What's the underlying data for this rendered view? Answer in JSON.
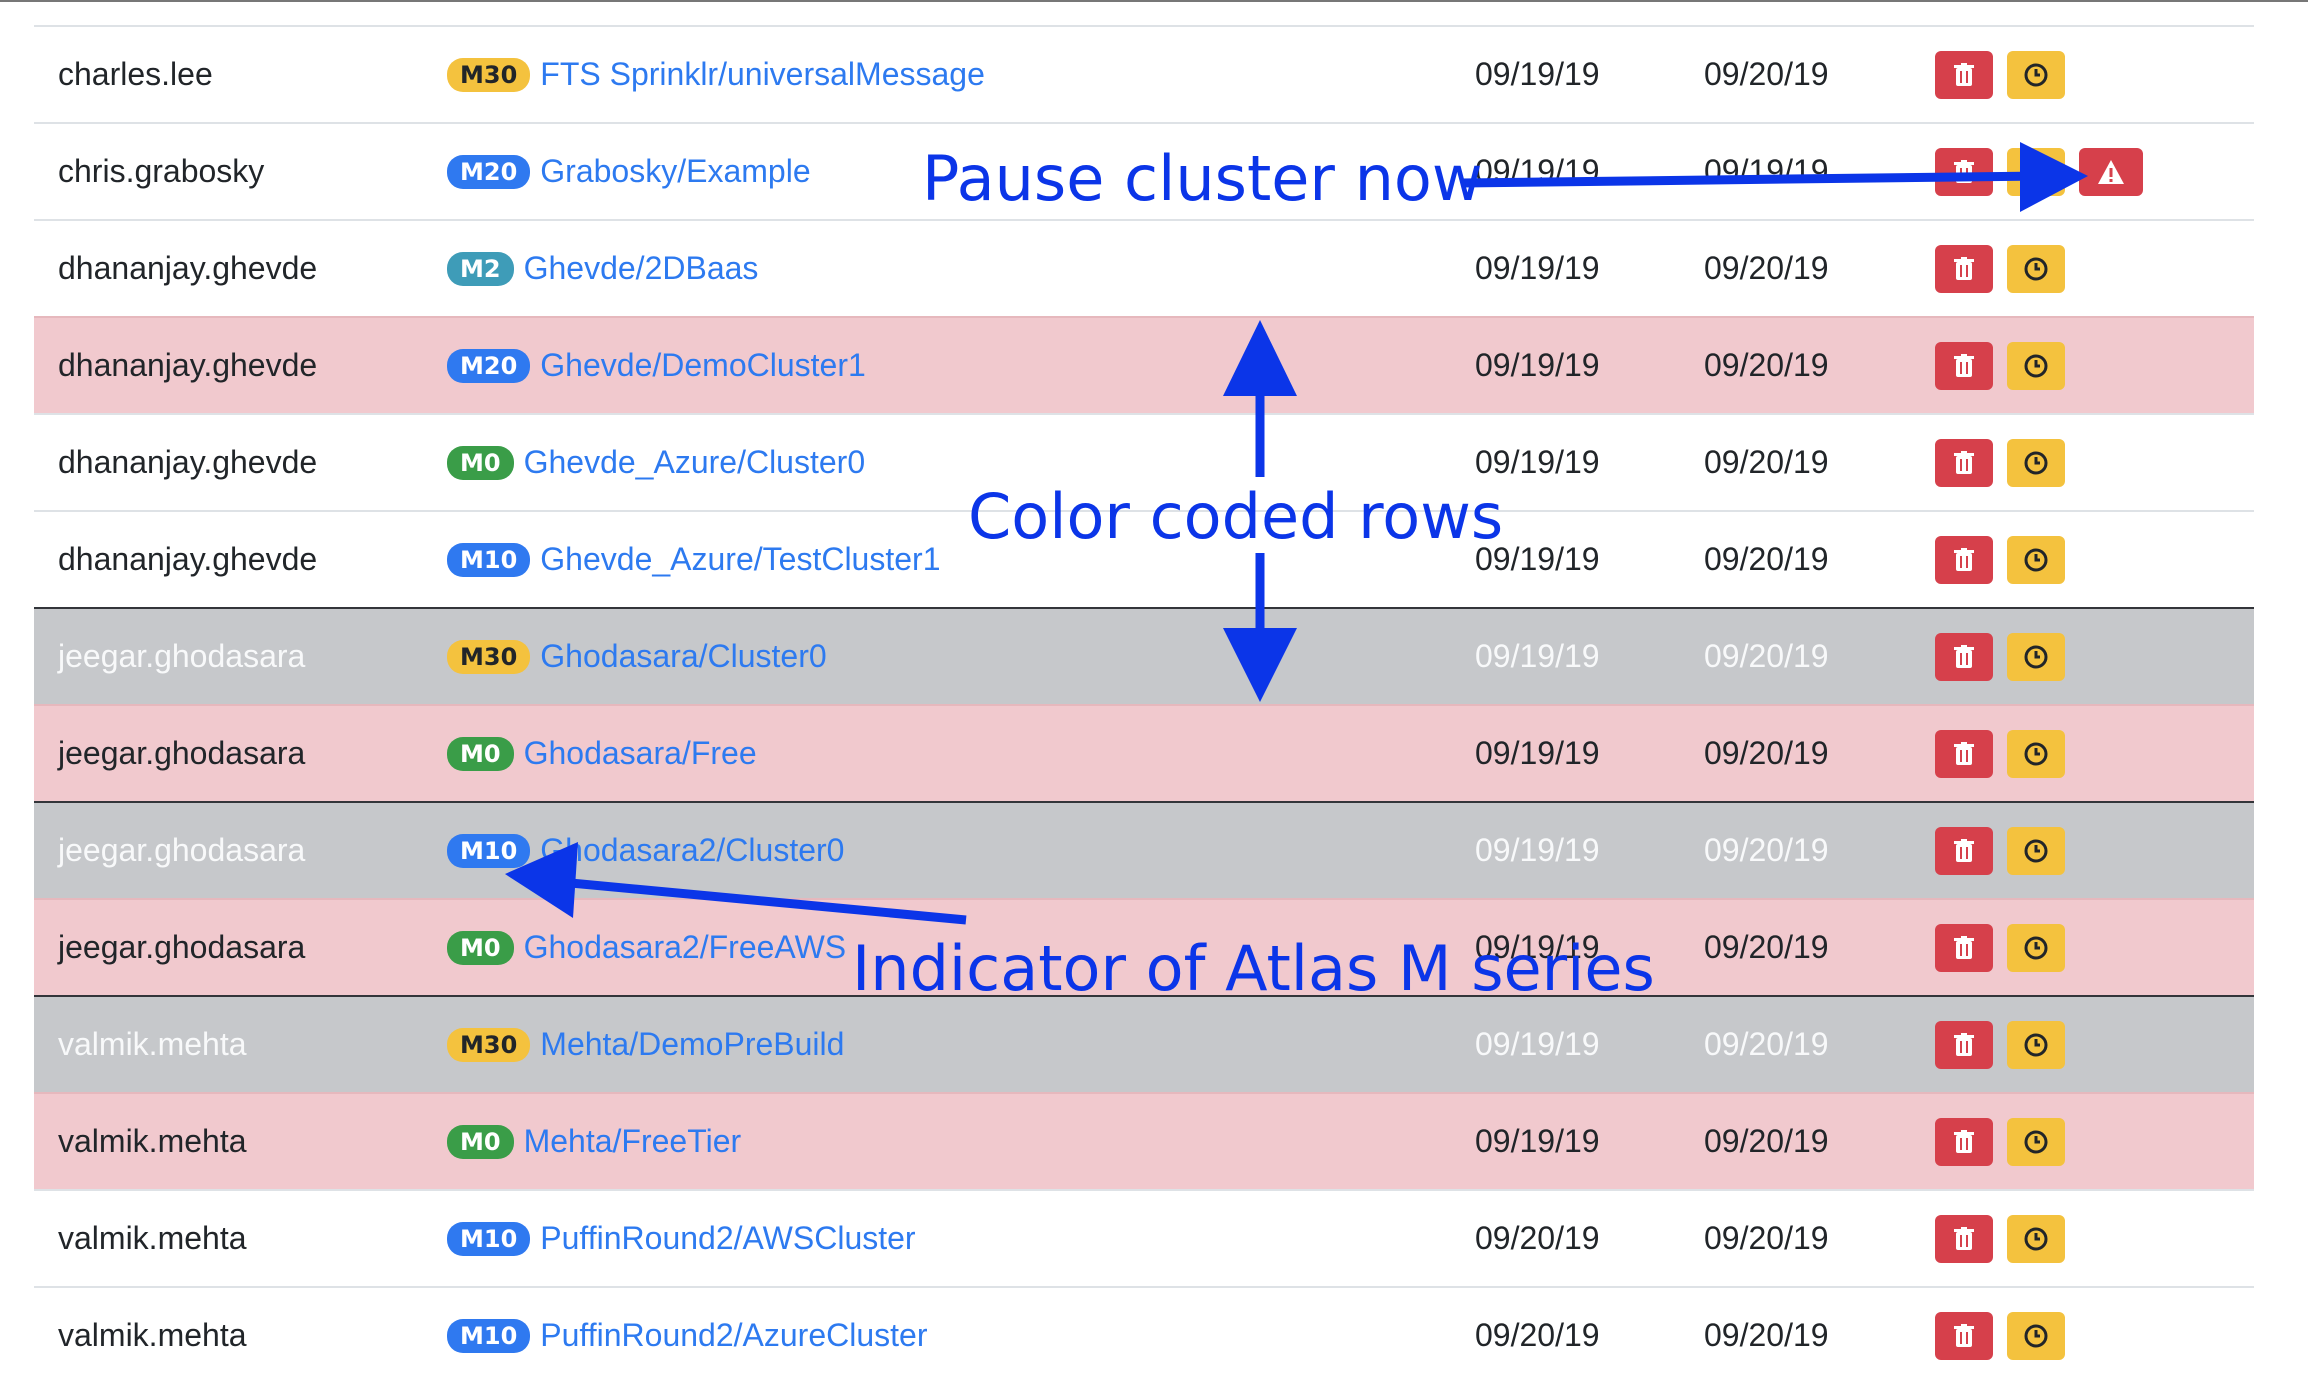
{
  "colors": {
    "link": "#2d7af0",
    "danger_row": "#f1c9ce",
    "secondary_row": "#c6c8cb",
    "annotation": "#0b35e8",
    "delete_button": "#d6404b",
    "pause_button": "#f4c23e"
  },
  "icons": {
    "delete": "trash-icon",
    "pause": "clock-icon",
    "warning": "warning-triangle-icon"
  },
  "rows": [
    {
      "owner": "charles.lee",
      "tier": "M30",
      "cluster": "FTS Sprinklr/universalMessage",
      "created": "09/19/19",
      "expires": "09/20/19",
      "style": "plain"
    },
    {
      "owner": "chris.grabosky",
      "tier": "M20",
      "cluster": "Grabosky/Example",
      "created": "09/19/19",
      "expires": "09/19/19",
      "style": "plain",
      "warning": true
    },
    {
      "owner": "dhananjay.ghevde",
      "tier": "M2",
      "cluster": "Ghevde/2DBaas",
      "created": "09/19/19",
      "expires": "09/20/19",
      "style": "plain"
    },
    {
      "owner": "dhananjay.ghevde",
      "tier": "M20",
      "cluster": "Ghevde/DemoCluster1",
      "created": "09/19/19",
      "expires": "09/20/19",
      "style": "danger"
    },
    {
      "owner": "dhananjay.ghevde",
      "tier": "M0",
      "cluster": "Ghevde_Azure/Cluster0",
      "created": "09/19/19",
      "expires": "09/20/19",
      "style": "plain"
    },
    {
      "owner": "dhananjay.ghevde",
      "tier": "M10",
      "cluster": "Ghevde_Azure/TestCluster1",
      "created": "09/19/19",
      "expires": "09/20/19",
      "style": "plain"
    },
    {
      "owner": "jeegar.ghodasara",
      "tier": "M30",
      "cluster": "Ghodasara/Cluster0",
      "created": "09/19/19",
      "expires": "09/20/19",
      "style": "secondary"
    },
    {
      "owner": "jeegar.ghodasara",
      "tier": "M0",
      "cluster": "Ghodasara/Free",
      "created": "09/19/19",
      "expires": "09/20/19",
      "style": "danger"
    },
    {
      "owner": "jeegar.ghodasara",
      "tier": "M10",
      "cluster": "Ghodasara2/Cluster0",
      "created": "09/19/19",
      "expires": "09/20/19",
      "style": "secondary"
    },
    {
      "owner": "jeegar.ghodasara",
      "tier": "M0",
      "cluster": "Ghodasara2/FreeAWS",
      "created": "09/19/19",
      "expires": "09/20/19",
      "style": "danger"
    },
    {
      "owner": "valmik.mehta",
      "tier": "M30",
      "cluster": "Mehta/DemoPreBuild",
      "created": "09/19/19",
      "expires": "09/20/19",
      "style": "secondary"
    },
    {
      "owner": "valmik.mehta",
      "tier": "M0",
      "cluster": "Mehta/FreeTier",
      "created": "09/19/19",
      "expires": "09/20/19",
      "style": "danger"
    },
    {
      "owner": "valmik.mehta",
      "tier": "M10",
      "cluster": "PuffinRound2/AWSCluster",
      "created": "09/20/19",
      "expires": "09/20/19",
      "style": "plain"
    },
    {
      "owner": "valmik.mehta",
      "tier": "M10",
      "cluster": "PuffinRound2/AzureCluster",
      "created": "09/20/19",
      "expires": "09/20/19",
      "style": "plain"
    }
  ],
  "annotations": {
    "pause": "Pause cluster now",
    "color_rows": "Color coded rows",
    "indicator": "Indicator of Atlas M series"
  }
}
